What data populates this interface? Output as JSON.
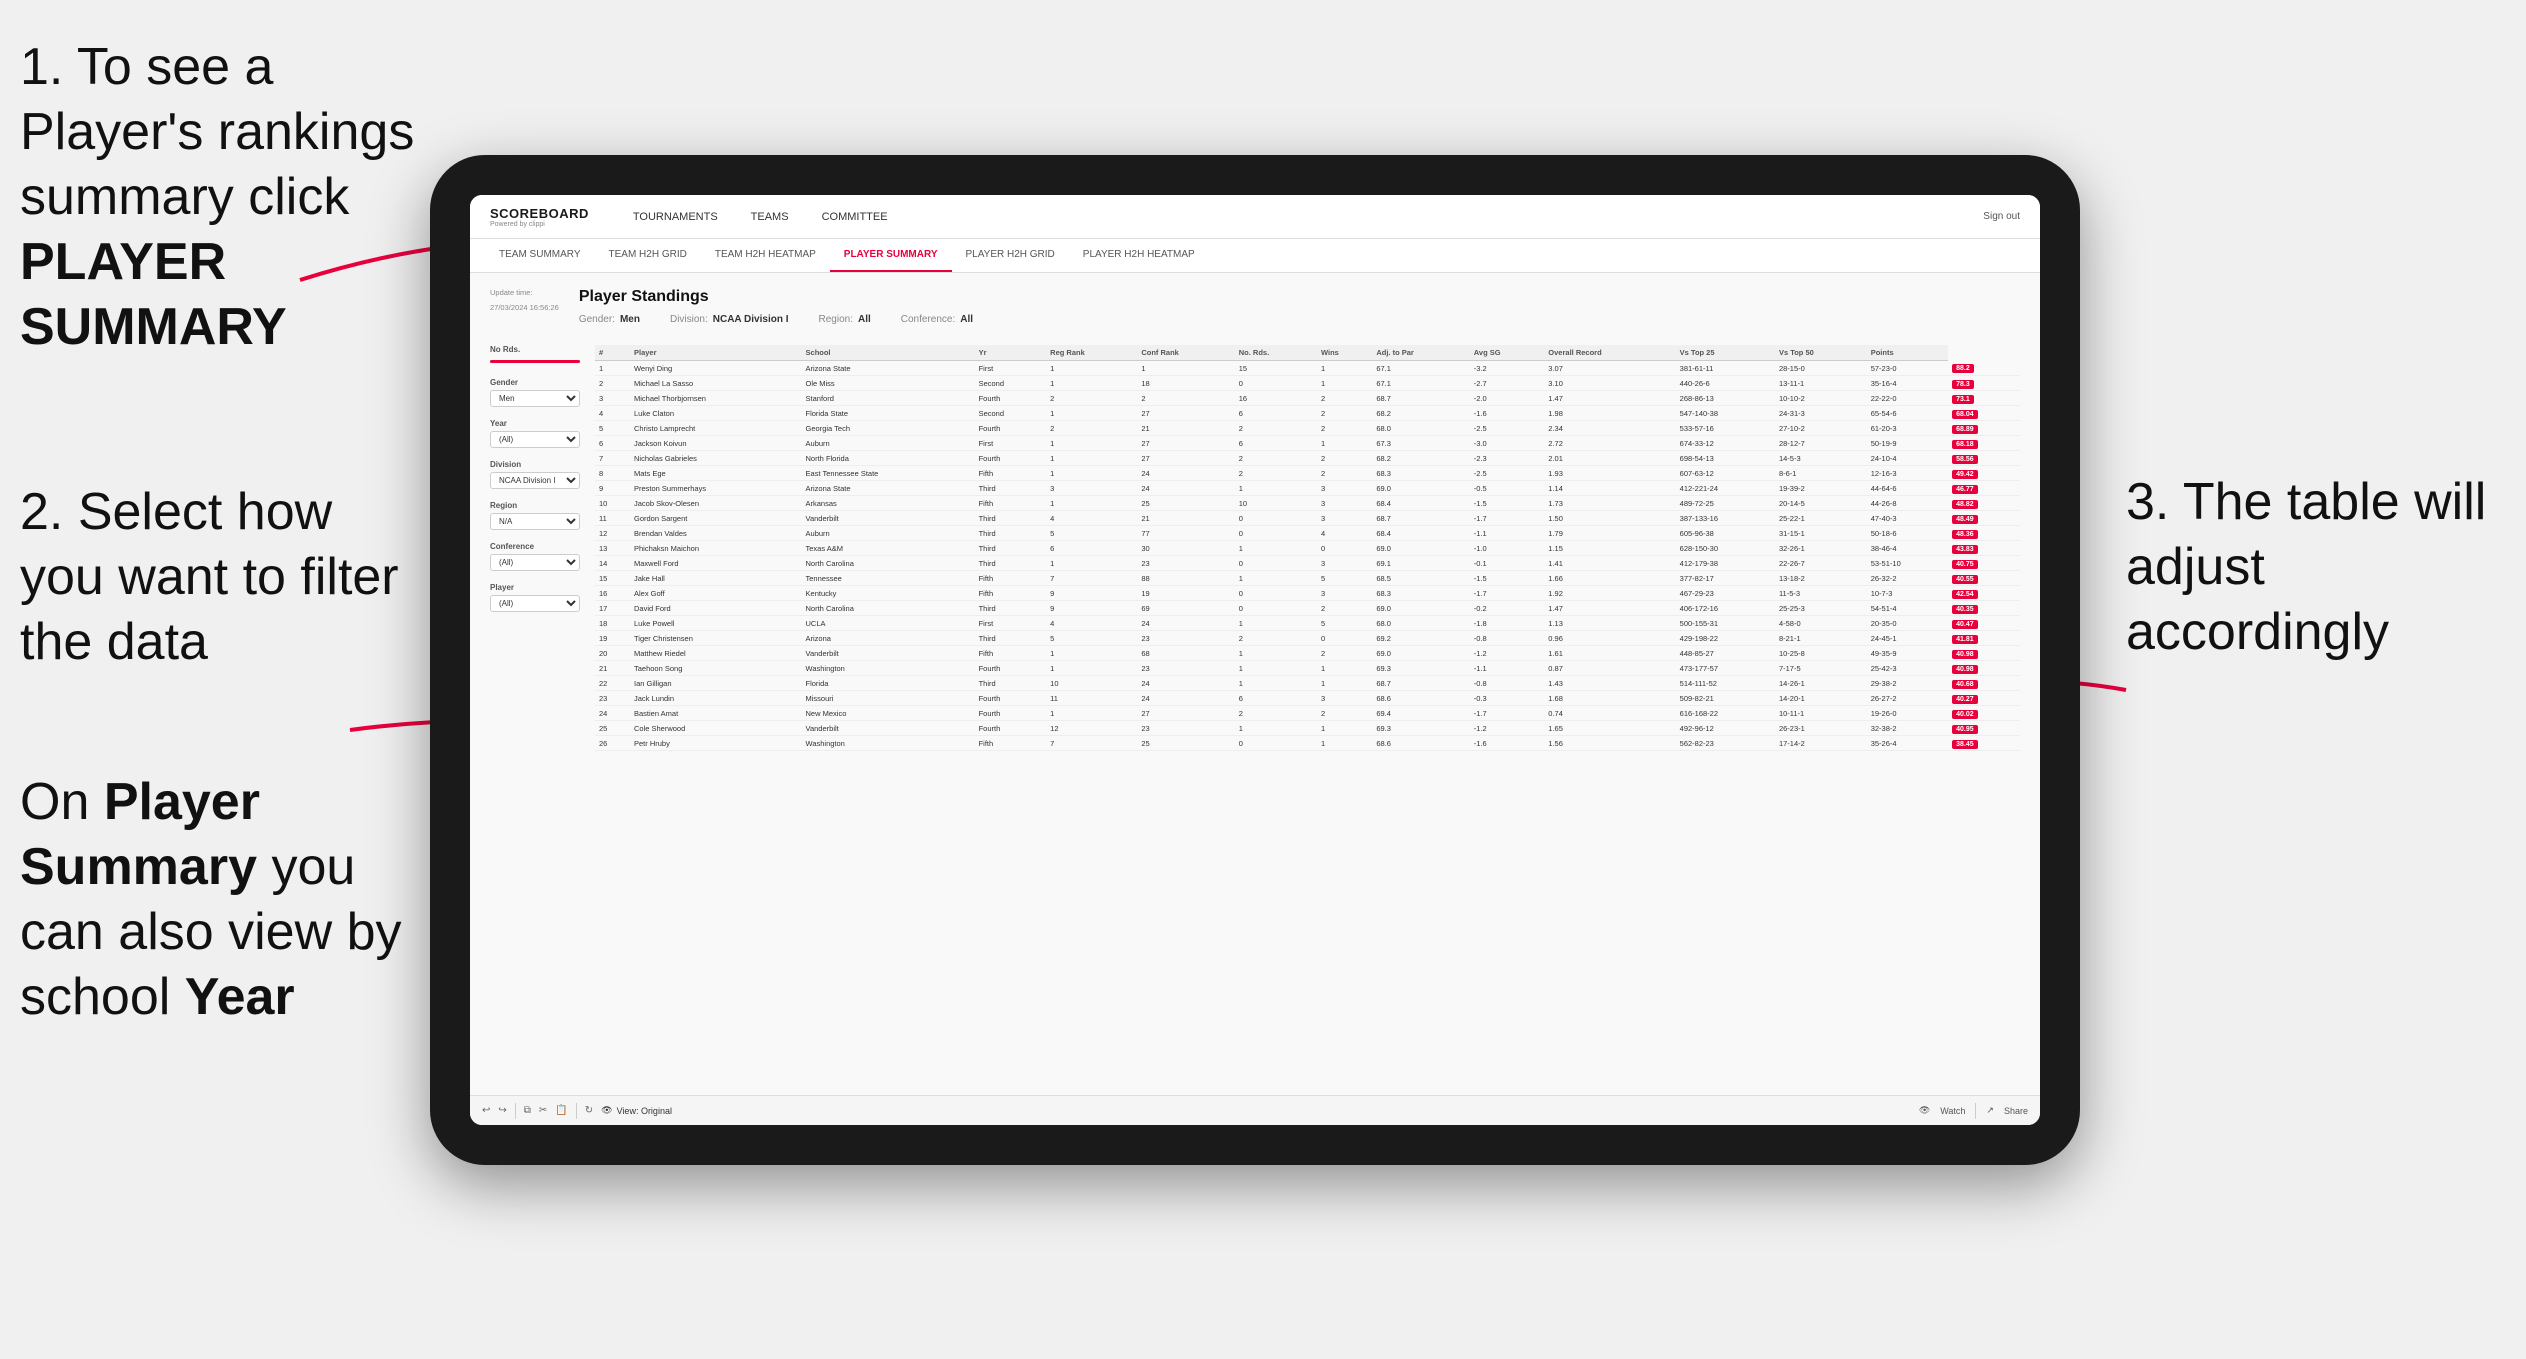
{
  "annotations": {
    "step1": "1. To see a Player's rankings summary click ",
    "step1_bold": "PLAYER SUMMARY",
    "step2_title": "2. Select how you want to filter the data",
    "step3": "3. The table will adjust accordingly",
    "step4_prefix": "On ",
    "step4_bold": "Player Summary",
    "step4_suffix": " you can also view by school ",
    "step4_year": "Year"
  },
  "nav": {
    "logo": "SCOREBOARD",
    "logo_sub": "Powered by clippi",
    "items": [
      "TOURNAMENTS",
      "TEAMS",
      "COMMITTEE"
    ],
    "sign_out": "Sign out"
  },
  "sub_nav": {
    "items": [
      "TEAM SUMMARY",
      "TEAM H2H GRID",
      "TEAM H2H HEATMAP",
      "PLAYER SUMMARY",
      "PLAYER H2H GRID",
      "PLAYER H2H HEATMAP"
    ],
    "active": "PLAYER SUMMARY"
  },
  "page": {
    "title": "Player Standings",
    "update_time": "Update time:",
    "update_date": "27/03/2024 16:56:26",
    "meta": {
      "gender_label": "Gender:",
      "gender_val": "Men",
      "division_label": "Division:",
      "division_val": "NCAA Division I",
      "region_label": "Region:",
      "region_val": "All",
      "conference_label": "Conference:",
      "conference_val": "All"
    }
  },
  "filters": {
    "no_rds_label": "No Rds.",
    "gender_label": "Gender",
    "gender_val": "Men",
    "year_label": "Year",
    "year_val": "(All)",
    "division_label": "Division",
    "division_val": "NCAA Division I",
    "region_label": "Region",
    "region_val": "N/A",
    "conference_label": "Conference",
    "conference_val": "(All)",
    "player_label": "Player",
    "player_val": "(All)"
  },
  "table": {
    "headers": [
      "#",
      "Player",
      "School",
      "Yr",
      "Reg Rank",
      "Conf Rank",
      "No. Rds.",
      "Wins",
      "Adj. to Par",
      "Avg SG",
      "Overall Record",
      "Vs Top 25",
      "Vs Top 50",
      "Points"
    ],
    "rows": [
      [
        "1",
        "Wenyi Ding",
        "Arizona State",
        "First",
        "1",
        "1",
        "15",
        "1",
        "67.1",
        "-3.2",
        "3.07",
        "381-61-11",
        "28-15-0",
        "57-23-0",
        "88.2"
      ],
      [
        "2",
        "Michael La Sasso",
        "Ole Miss",
        "Second",
        "1",
        "18",
        "0",
        "1",
        "67.1",
        "-2.7",
        "3.10",
        "440-26-6",
        "13-11-1",
        "35-16-4",
        "78.3"
      ],
      [
        "3",
        "Michael Thorbjornsen",
        "Stanford",
        "Fourth",
        "2",
        "2",
        "16",
        "2",
        "68.7",
        "-2.0",
        "1.47",
        "268-86-13",
        "10-10-2",
        "22-22-0",
        "73.1"
      ],
      [
        "4",
        "Luke Claton",
        "Florida State",
        "Second",
        "1",
        "27",
        "6",
        "2",
        "68.2",
        "-1.6",
        "1.98",
        "547-140-38",
        "24-31-3",
        "65-54-6",
        "68.04"
      ],
      [
        "5",
        "Christo Lamprecht",
        "Georgia Tech",
        "Fourth",
        "2",
        "21",
        "2",
        "2",
        "68.0",
        "-2.5",
        "2.34",
        "533-57-16",
        "27-10-2",
        "61-20-3",
        "68.89"
      ],
      [
        "6",
        "Jackson Koivun",
        "Auburn",
        "First",
        "1",
        "27",
        "6",
        "1",
        "67.3",
        "-3.0",
        "2.72",
        "674-33-12",
        "28-12-7",
        "50-19-9",
        "68.18"
      ],
      [
        "7",
        "Nicholas Gabrieles",
        "North Florida",
        "Fourth",
        "1",
        "27",
        "2",
        "2",
        "68.2",
        "-2.3",
        "2.01",
        "698-54-13",
        "14-5-3",
        "24-10-4",
        "58.56"
      ],
      [
        "8",
        "Mats Ege",
        "East Tennessee State",
        "Fifth",
        "1",
        "24",
        "2",
        "2",
        "68.3",
        "-2.5",
        "1.93",
        "607-63-12",
        "8-6-1",
        "12-16-3",
        "49.42"
      ],
      [
        "9",
        "Preston Summerhays",
        "Arizona State",
        "Third",
        "3",
        "24",
        "1",
        "3",
        "69.0",
        "-0.5",
        "1.14",
        "412-221-24",
        "19-39-2",
        "44-64-6",
        "46.77"
      ],
      [
        "10",
        "Jacob Skov-Olesen",
        "Arkansas",
        "Fifth",
        "1",
        "25",
        "10",
        "3",
        "68.4",
        "-1.5",
        "1.73",
        "489-72-25",
        "20-14-5",
        "44-26-8",
        "48.82"
      ],
      [
        "11",
        "Gordon Sargent",
        "Vanderbilt",
        "Third",
        "4",
        "21",
        "0",
        "3",
        "68.7",
        "-1.7",
        "1.50",
        "387-133-16",
        "25-22-1",
        "47-40-3",
        "48.49"
      ],
      [
        "12",
        "Brendan Valdes",
        "Auburn",
        "Third",
        "5",
        "77",
        "0",
        "4",
        "68.4",
        "-1.1",
        "1.79",
        "605-96-38",
        "31-15-1",
        "50-18-6",
        "48.36"
      ],
      [
        "13",
        "Phichaksn Maichon",
        "Texas A&M",
        "Third",
        "6",
        "30",
        "1",
        "0",
        "69.0",
        "-1.0",
        "1.15",
        "628-150-30",
        "32-26-1",
        "38-46-4",
        "43.83"
      ],
      [
        "14",
        "Maxwell Ford",
        "North Carolina",
        "Third",
        "1",
        "23",
        "0",
        "3",
        "69.1",
        "-0.1",
        "1.41",
        "412-179-38",
        "22-26-7",
        "53-51-10",
        "40.75"
      ],
      [
        "15",
        "Jake Hall",
        "Tennessee",
        "Fifth",
        "7",
        "88",
        "1",
        "5",
        "68.5",
        "-1.5",
        "1.66",
        "377-82-17",
        "13-18-2",
        "26-32-2",
        "40.55"
      ],
      [
        "16",
        "Alex Goff",
        "Kentucky",
        "Fifth",
        "9",
        "19",
        "0",
        "3",
        "68.3",
        "-1.7",
        "1.92",
        "467-29-23",
        "11-5-3",
        "10-7-3",
        "42.54"
      ],
      [
        "17",
        "David Ford",
        "North Carolina",
        "Third",
        "9",
        "69",
        "0",
        "2",
        "69.0",
        "-0.2",
        "1.47",
        "406-172-16",
        "25-25-3",
        "54-51-4",
        "40.35"
      ],
      [
        "18",
        "Luke Powell",
        "UCLA",
        "First",
        "4",
        "24",
        "1",
        "5",
        "68.0",
        "-1.8",
        "1.13",
        "500-155-31",
        "4-58-0",
        "20-35-0",
        "40.47"
      ],
      [
        "19",
        "Tiger Christensen",
        "Arizona",
        "Third",
        "5",
        "23",
        "2",
        "0",
        "69.2",
        "-0.8",
        "0.96",
        "429-198-22",
        "8-21-1",
        "24-45-1",
        "41.81"
      ],
      [
        "20",
        "Matthew Riedel",
        "Vanderbilt",
        "Fifth",
        "1",
        "68",
        "1",
        "2",
        "69.0",
        "-1.2",
        "1.61",
        "448-85-27",
        "10-25-8",
        "49-35-9",
        "40.98"
      ],
      [
        "21",
        "Taehoon Song",
        "Washington",
        "Fourth",
        "1",
        "23",
        "1",
        "1",
        "69.3",
        "-1.1",
        "0.87",
        "473-177-57",
        "7-17-5",
        "25-42-3",
        "40.98"
      ],
      [
        "22",
        "Ian Gilligan",
        "Florida",
        "Third",
        "10",
        "24",
        "1",
        "1",
        "68.7",
        "-0.8",
        "1.43",
        "514-111-52",
        "14-26-1",
        "29-38-2",
        "40.68"
      ],
      [
        "23",
        "Jack Lundin",
        "Missouri",
        "Fourth",
        "11",
        "24",
        "6",
        "3",
        "68.6",
        "-0.3",
        "1.68",
        "509-82-21",
        "14-20-1",
        "26-27-2",
        "40.27"
      ],
      [
        "24",
        "Bastien Amat",
        "New Mexico",
        "Fourth",
        "1",
        "27",
        "2",
        "2",
        "69.4",
        "-1.7",
        "0.74",
        "616-168-22",
        "10-11-1",
        "19-26-0",
        "40.02"
      ],
      [
        "25",
        "Cole Sherwood",
        "Vanderbilt",
        "Fourth",
        "12",
        "23",
        "1",
        "1",
        "69.3",
        "-1.2",
        "1.65",
        "492-96-12",
        "26-23-1",
        "32-38-2",
        "40.95"
      ],
      [
        "26",
        "Petr Hruby",
        "Washington",
        "Fifth",
        "7",
        "25",
        "0",
        "1",
        "68.6",
        "-1.6",
        "1.56",
        "562-82-23",
        "17-14-2",
        "35-26-4",
        "38.45"
      ]
    ]
  },
  "toolbar": {
    "view_label": "View: Original",
    "watch_label": "Watch",
    "share_label": "Share"
  }
}
